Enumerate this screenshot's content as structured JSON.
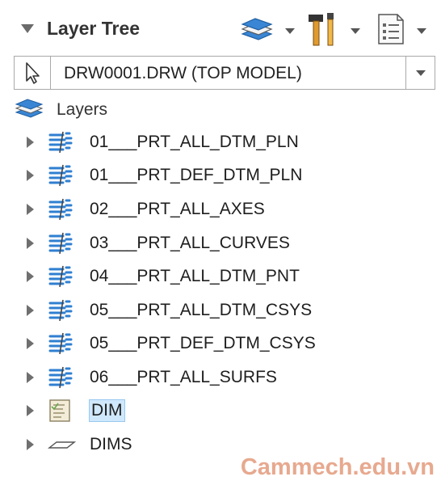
{
  "header": {
    "title": "Layer Tree",
    "tools": [
      "layers-icon",
      "hammer-icon",
      "settings-list-icon"
    ]
  },
  "model_selector": {
    "value": "DRW0001.DRW (TOP MODEL)"
  },
  "tree": {
    "root_label": "Layers",
    "items": [
      {
        "label": "01___PRT_ALL_DTM_PLN",
        "icon": "layer-stack-icon"
      },
      {
        "label": "01___PRT_DEF_DTM_PLN",
        "icon": "layer-stack-icon"
      },
      {
        "label": "02___PRT_ALL_AXES",
        "icon": "layer-stack-icon"
      },
      {
        "label": "03___PRT_ALL_CURVES",
        "icon": "layer-stack-icon"
      },
      {
        "label": "04___PRT_ALL_DTM_PNT",
        "icon": "layer-stack-icon"
      },
      {
        "label": "05___PRT_ALL_DTM_CSYS",
        "icon": "layer-stack-icon"
      },
      {
        "label": "05___PRT_DEF_DTM_CSYS",
        "icon": "layer-stack-icon"
      },
      {
        "label": "06___PRT_ALL_SURFS",
        "icon": "layer-stack-icon"
      },
      {
        "label": "DIM",
        "icon": "note-layer-icon",
        "selected": true
      },
      {
        "label": "DIMS",
        "icon": "flat-layer-icon"
      }
    ]
  },
  "watermark": "Cammech.edu.vn",
  "colors": {
    "layer_icon_blue": "#2f7fd1",
    "selection_highlight": "#cfe8fc",
    "watermark": "#e7a98f"
  }
}
